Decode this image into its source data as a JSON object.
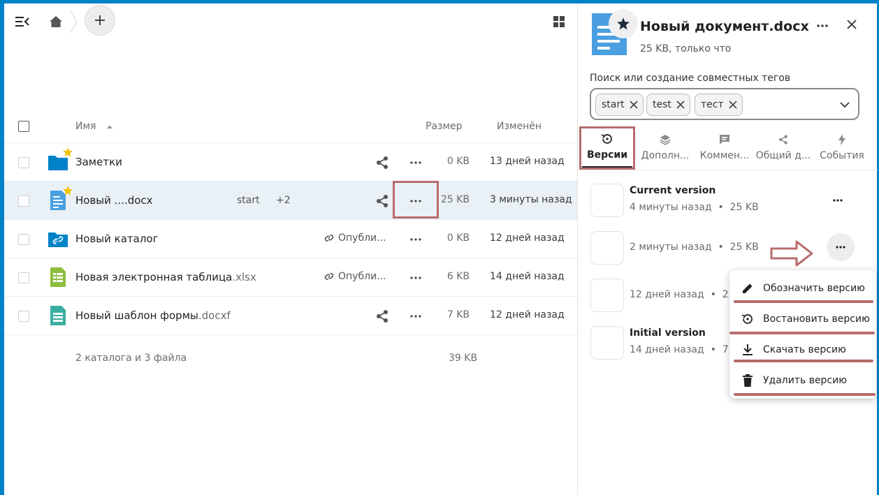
{
  "breadcrumb": {
    "home_icon": "home-icon",
    "add_icon": "plus-icon"
  },
  "table": {
    "headers": {
      "name": "Имя",
      "size": "Размер",
      "modified": "Изменён"
    },
    "rows": [
      {
        "name": "Заметки",
        "ext": "",
        "size": "0 KB",
        "modified": "13 дней назад",
        "type": "folder",
        "favorite": true,
        "share": "share"
      },
      {
        "name": "Новый ....docx",
        "ext": "",
        "size": "25 KB",
        "modified": "3 минуты назад",
        "type": "document",
        "favorite": true,
        "share": "share",
        "tag": "start",
        "tag_more": "+2"
      },
      {
        "name": "Новый каталог",
        "ext": "",
        "size": "0 KB",
        "modified": "12 дней назад",
        "type": "folder-link",
        "favorite": false,
        "published": "Опубли..."
      },
      {
        "name": "Новая электронная таблица",
        "ext": ".xlsx",
        "size": "6 KB",
        "modified": "14 дней назад",
        "type": "spreadsheet",
        "favorite": false,
        "published": "Опубли..."
      },
      {
        "name": "Новый шаблон формы",
        "ext": ".docxf",
        "size": "7 KB",
        "modified": "12 дней назад",
        "type": "form",
        "favorite": false,
        "share": "share"
      }
    ],
    "summary": "2 каталога и 3 файла",
    "summary_size": "39 KB"
  },
  "sidebar": {
    "title": "Новый документ.docx",
    "subtitle": "25 KB, только что",
    "tags_label": "Поиск или создание совместных тегов",
    "tags": [
      "start",
      "test",
      "тест"
    ],
    "tabs": [
      {
        "label": "Версии",
        "icon": "history-icon",
        "active": true
      },
      {
        "label": "Дополн...",
        "icon": "layers-icon",
        "active": false
      },
      {
        "label": "Коммен...",
        "icon": "comment-icon",
        "active": false
      },
      {
        "label": "Общий д...",
        "icon": "share-icon",
        "active": false
      },
      {
        "label": "События",
        "icon": "flash-icon",
        "active": false
      }
    ],
    "versions": [
      {
        "title": "Current version",
        "time": "4 минуты назад",
        "size": "25 KB"
      },
      {
        "title": "",
        "time": "2 минуты назад",
        "size": "25 KB"
      },
      {
        "title": "",
        "time": "12 дней назад",
        "size": "25"
      },
      {
        "title": "Initial version",
        "time": "14 дней назад",
        "size": "7 K"
      }
    ],
    "menu": [
      {
        "label": "Обозначить версию",
        "icon": "pencil-icon"
      },
      {
        "label": "Востановить версию",
        "icon": "restore-icon"
      },
      {
        "label": "Скачать версию",
        "icon": "download-icon"
      },
      {
        "label": "Удалить версию",
        "icon": "trash-icon"
      }
    ]
  },
  "colors": {
    "accent": "#0082c9",
    "highlight": "#b86b6b",
    "selected_row": "#e9f1f6",
    "folder": "#0082c9",
    "doc": "#4a9fe0",
    "sheet": "#8dbf3f",
    "form": "#3aaea0"
  }
}
